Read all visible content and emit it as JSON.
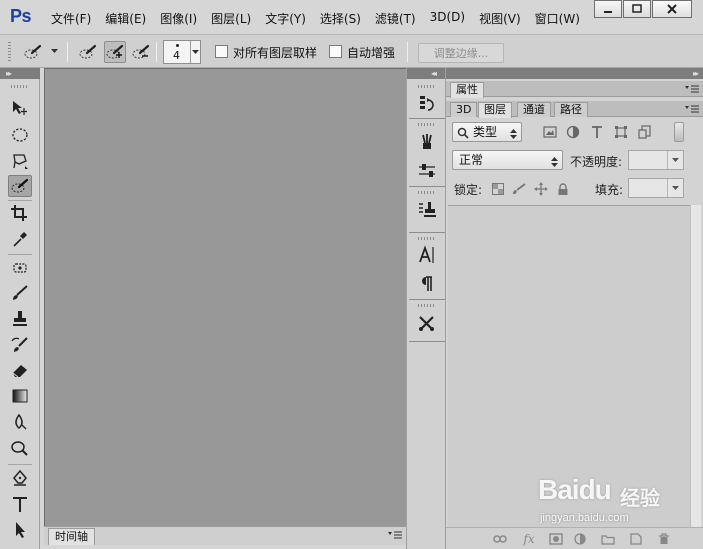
{
  "app": {
    "logo": "Ps"
  },
  "menu": [
    "文件(F)",
    "编辑(E)",
    "图像(I)",
    "图层(L)",
    "文字(Y)",
    "选择(S)",
    "滤镜(T)",
    "3D(D)",
    "视图(V)",
    "窗口(W)"
  ],
  "options": {
    "brush_size": "4",
    "sample_all_layers_label": "对所有图层取样",
    "sample_all_layers_checked": false,
    "auto_enhance_label": "自动增强",
    "auto_enhance_checked": false,
    "refine_edge_label": "调整边缘..."
  },
  "tools": [
    {
      "name": "move-tool-icon"
    },
    {
      "name": "elliptical-marquee-tool-icon"
    },
    {
      "name": "polygonal-lasso-tool-icon"
    },
    {
      "name": "quick-selection-tool-icon",
      "active": true
    },
    {
      "name": "crop-tool-icon"
    },
    {
      "name": "eyedropper-tool-icon"
    },
    {
      "name": "spot-healing-brush-tool-icon"
    },
    {
      "name": "brush-tool-icon"
    },
    {
      "name": "clone-stamp-tool-icon"
    },
    {
      "name": "history-brush-tool-icon"
    },
    {
      "name": "eraser-tool-icon"
    },
    {
      "name": "gradient-tool-icon"
    },
    {
      "name": "blur-tool-icon"
    },
    {
      "name": "dodge-tool-icon"
    },
    {
      "name": "pen-tool-icon"
    },
    {
      "name": "type-tool-icon"
    },
    {
      "name": "path-selection-tool-icon"
    }
  ],
  "timeline": {
    "tab_label": "时间轴"
  },
  "dock_icons": [
    "history-icon",
    "brush-presets-icon",
    "brush-settings-icon",
    "clone-source-icon",
    "character-icon",
    "paragraph-icon",
    "tool-presets-icon"
  ],
  "properties_panel": {
    "tab_label": "属性"
  },
  "layers_panel": {
    "tabs": [
      "3D",
      "图层",
      "通道",
      "路径"
    ],
    "active_tab": "图层",
    "filter_kind_label": "类型",
    "blend_mode": "正常",
    "opacity_label": "不透明度:",
    "lock_label": "锁定:",
    "fill_label": "填充:",
    "footer_icons": [
      "link-layers-icon",
      "fx-icon",
      "add-mask-icon",
      "adjustment-layer-icon",
      "new-group-icon",
      "new-layer-icon",
      "delete-layer-icon"
    ]
  },
  "watermark": {
    "brand": "Baidu",
    "brand_cn": "经验",
    "url": "jingyan.baidu.com"
  }
}
